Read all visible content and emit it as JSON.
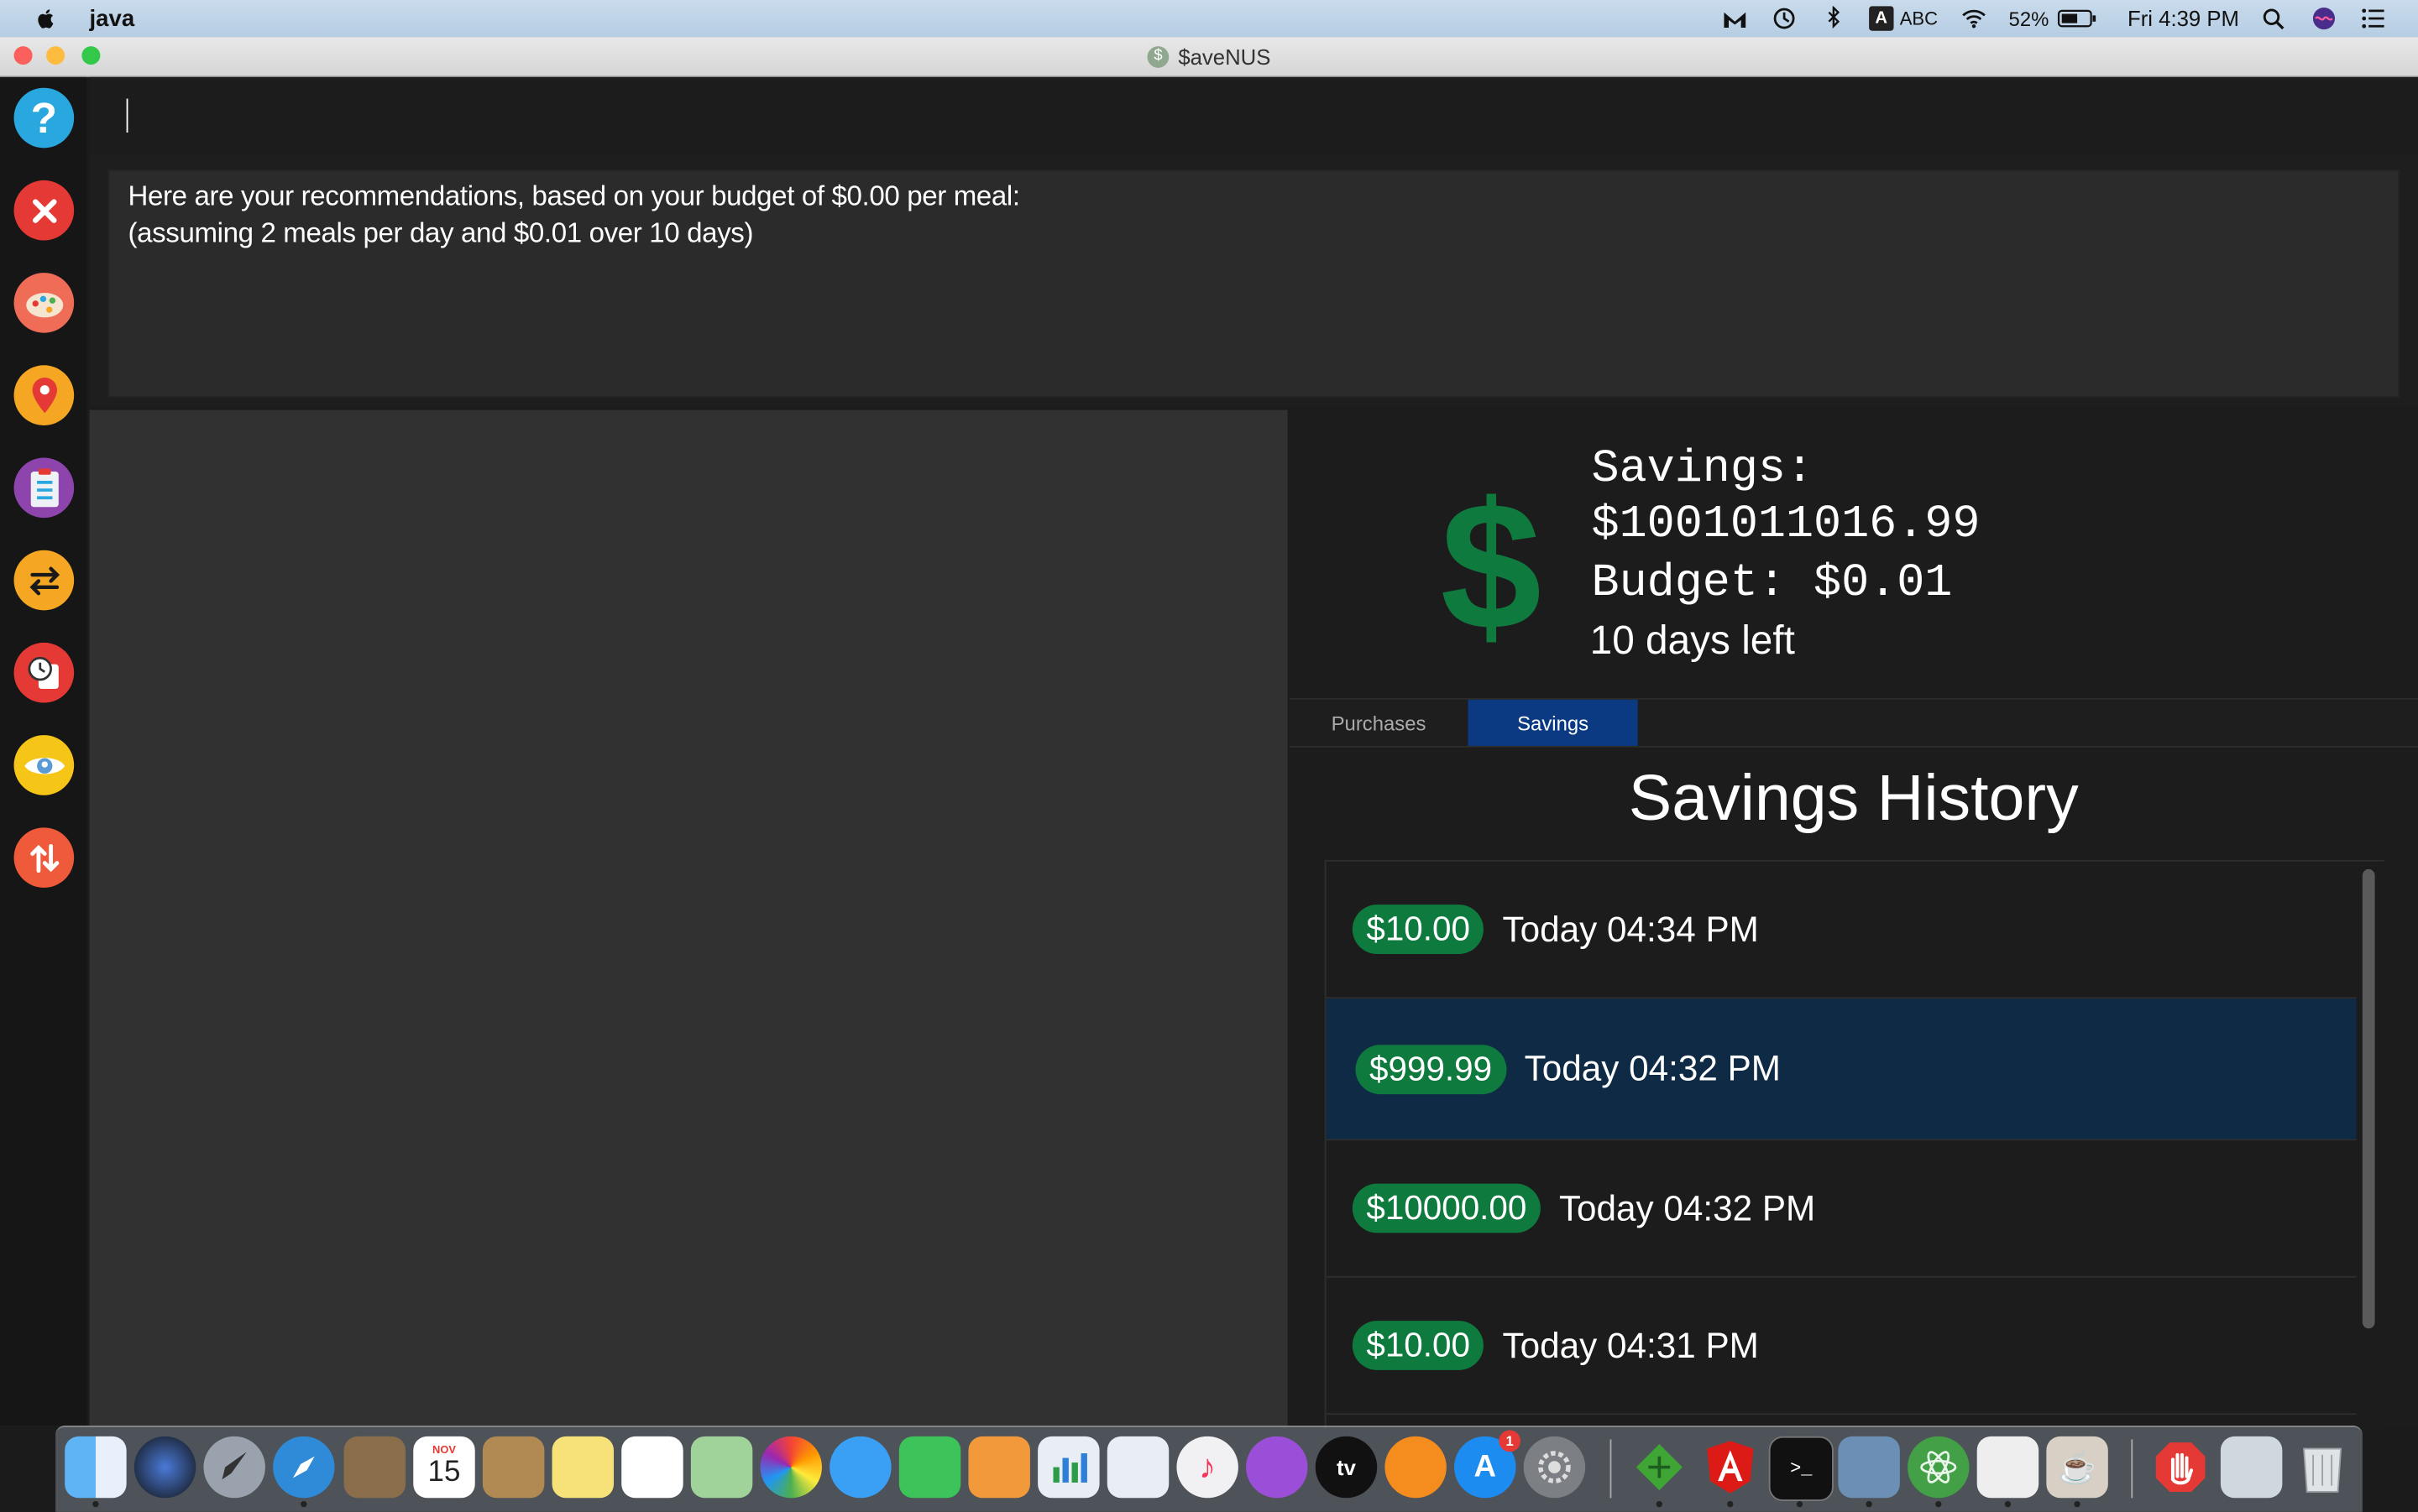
{
  "menubar": {
    "app_name": "java",
    "battery": "52%",
    "clock": "Fri 4:39 PM",
    "input_source": "ABC",
    "input_badge": "A"
  },
  "window": {
    "title": "$aveNUS",
    "title_icon": "$"
  },
  "sidebar": {
    "items": [
      {
        "icon": "help-icon",
        "color": "#29a8e0"
      },
      {
        "icon": "close-icon",
        "color": "#e53935"
      },
      {
        "icon": "palette-icon",
        "color": "#ef6c57"
      },
      {
        "icon": "location-pin-icon",
        "color": "#f5a623"
      },
      {
        "icon": "clipboard-icon",
        "color": "#8e44ad"
      },
      {
        "icon": "swap-icon",
        "color": "#f5a623"
      },
      {
        "icon": "clock-icon",
        "color": "#e53935"
      },
      {
        "icon": "eye-icon",
        "color": "#f5c518"
      },
      {
        "icon": "sort-icon",
        "color": "#ef5a3a"
      }
    ]
  },
  "command": {
    "value": "",
    "placeholder": ""
  },
  "result": {
    "line1": "Here are your recommendations, based on your budget of $0.00 per meal:",
    "line2": "(assuming 2 meals per day and $0.01 over 10 days)"
  },
  "savings_panel": {
    "icon": "$",
    "savings_label": "Savings:",
    "savings_value": "$1001011016.99",
    "budget_line": "Budget: $0.01",
    "days_left": "10 days left"
  },
  "tabs": [
    {
      "label": "Purchases",
      "active": false
    },
    {
      "label": "Savings",
      "active": true
    }
  ],
  "history": {
    "title": "Savings History",
    "rows": [
      {
        "amount": "$10.00",
        "time": "Today 04:34 PM",
        "selected": false
      },
      {
        "amount": "$999.99",
        "time": "Today 04:32 PM",
        "selected": true
      },
      {
        "amount": "$10000.00",
        "time": "Today 04:32 PM",
        "selected": false
      },
      {
        "amount": "$10.00",
        "time": "Today 04:31 PM",
        "selected": false
      }
    ]
  },
  "dock": {
    "calendar_month": "NOV",
    "calendar_day": "15",
    "appstore_badge": "1",
    "tv_label": "tv"
  },
  "colors": {
    "accent_green": "#0e7a3e",
    "selected_row": "#0f2a45",
    "active_tab": "#0b3a82"
  }
}
